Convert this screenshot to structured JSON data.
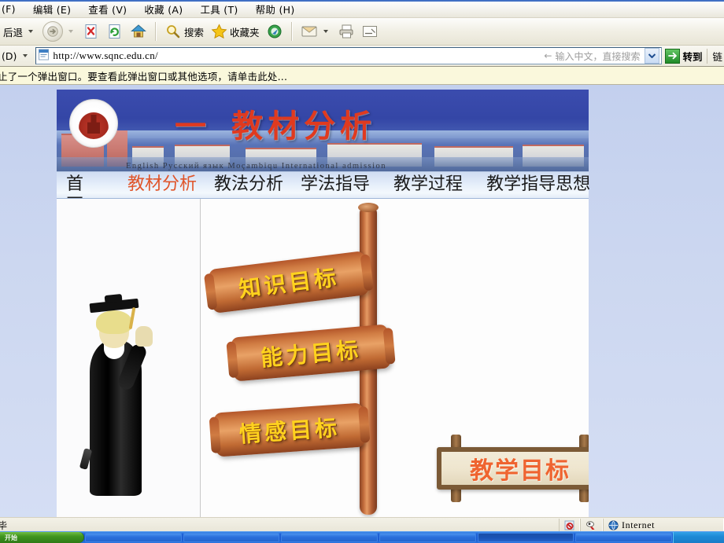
{
  "browser": {
    "menu": [
      {
        "label": "(F)",
        "name": "menu-file"
      },
      {
        "label": "编辑 (E)",
        "name": "menu-edit"
      },
      {
        "label": "查看 (V)",
        "name": "menu-view"
      },
      {
        "label": "收藏 (A)",
        "name": "menu-favorites"
      },
      {
        "label": "工具 (T)",
        "name": "menu-tools"
      },
      {
        "label": "帮助 (H)",
        "name": "menu-help"
      }
    ],
    "toolbar": {
      "back_label": "后退",
      "search_label": "搜索",
      "favorites_label": "收藏夹"
    },
    "address": {
      "label": "(D)",
      "url": "http://www.sqnc.edu.cn/",
      "search_hint": "输入中文，直接搜索",
      "go_label": "转到",
      "links_label": "链"
    },
    "infobar": {
      "text": "止了一个弹出窗口。要查看此弹出窗口或其他选项，请单击此处..."
    },
    "status": {
      "text": "毕",
      "zone": "Internet"
    }
  },
  "page": {
    "banner": {
      "number": "一",
      "title": "教材分析",
      "languages": "English   Русский язык   Moçambiqu   International admission"
    },
    "nav": [
      {
        "label": "首页",
        "name": "nav-home",
        "active": false
      },
      {
        "label": "教材分析",
        "name": "nav-textbook-analysis",
        "active": true
      },
      {
        "label": "教法分析",
        "name": "nav-teaching-method-analysis",
        "active": false
      },
      {
        "label": "学法指导",
        "name": "nav-learning-guidance",
        "active": false
      },
      {
        "label": "教学过程",
        "name": "nav-teaching-process",
        "active": false
      },
      {
        "label": "教学指导思想",
        "name": "nav-teaching-philosophy",
        "active": false
      }
    ],
    "signs": [
      {
        "label": "知识目标",
        "name": "sign-knowledge-goal"
      },
      {
        "label": "能力目标",
        "name": "sign-ability-goal"
      },
      {
        "label": "情感目标",
        "name": "sign-emotion-goal"
      }
    ],
    "board": {
      "label": "教学目标"
    }
  },
  "taskbar": {
    "start_label": "开始"
  },
  "colors": {
    "accent_red": "#e03a1f",
    "nav_active": "#e0552a",
    "sign_text": "#ffd21e",
    "board_text": "#ef6430",
    "banner_bg": "#3446a6",
    "taskbar_blue": "#1f62d6"
  }
}
